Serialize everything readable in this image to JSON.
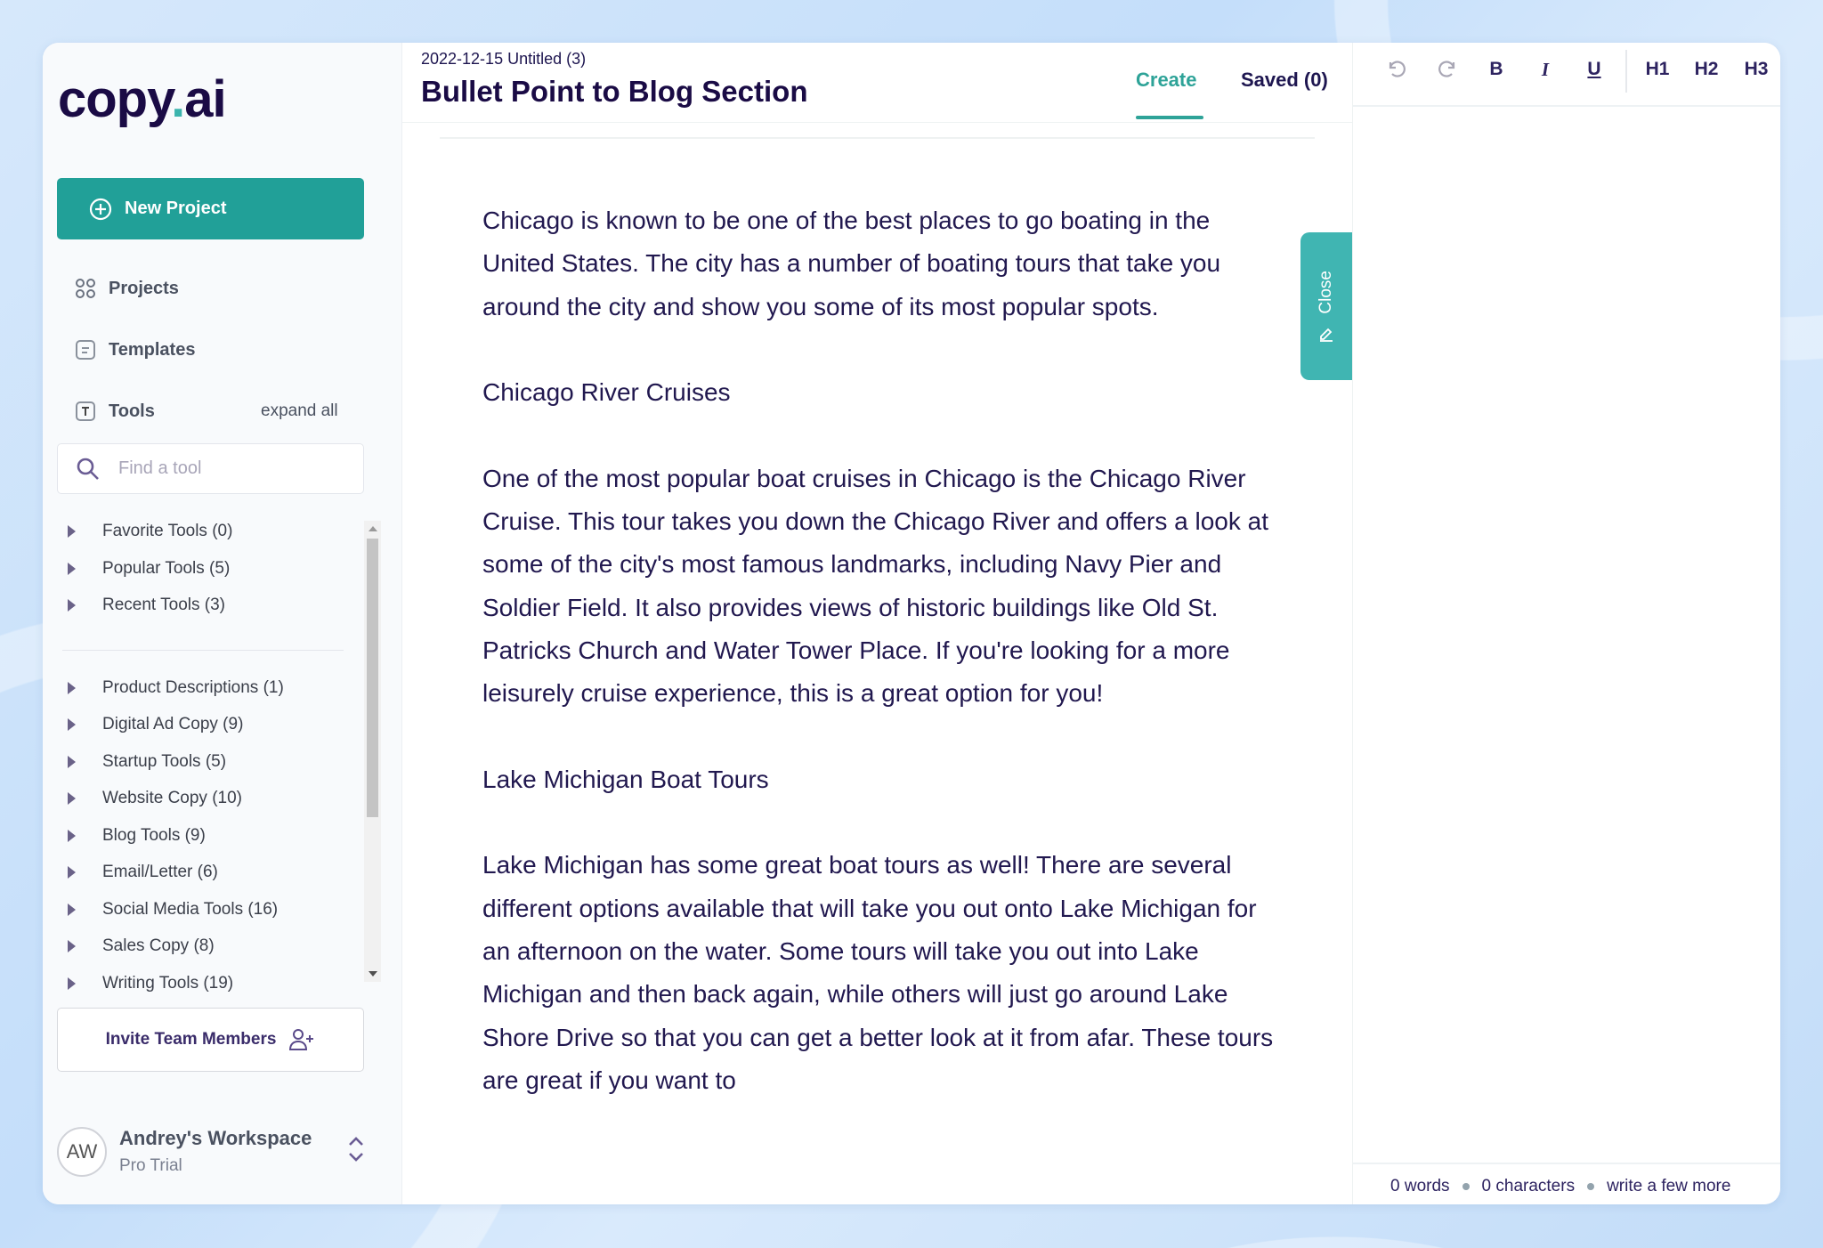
{
  "brand": {
    "logo_text_a": "copy",
    "logo_dot": ".",
    "logo_text_b": "ai",
    "accent": "#21a098"
  },
  "sidebar": {
    "new_project": "New Project",
    "nav": [
      {
        "label": "Projects",
        "icon": "grid-icon"
      },
      {
        "label": "Templates",
        "icon": "template-icon"
      },
      {
        "label": "Tools",
        "icon": "tools-icon"
      }
    ],
    "expand_all": "expand all",
    "search_placeholder": "Find a tool",
    "tool_groups_top": [
      "Favorite Tools (0)",
      "Popular Tools (5)",
      "Recent Tools (3)"
    ],
    "tool_groups": [
      "Product Descriptions (1)",
      "Digital Ad Copy (9)",
      "Startup Tools (5)",
      "Website Copy (10)",
      "Blog Tools (9)",
      "Email/Letter (6)",
      "Social Media Tools (16)",
      "Sales Copy (8)",
      "Writing Tools (19)"
    ],
    "invite": "Invite Team Members",
    "workspace": {
      "initials": "AW",
      "name": "Andrey's Workspace",
      "plan": "Pro Trial"
    }
  },
  "main": {
    "date": "2022-12-15 Untitled (3)",
    "title": "Bullet Point to Blog Section",
    "tabs": {
      "create": "Create",
      "saved": "Saved (0)"
    },
    "close": "Close",
    "content": [
      "Chicago is known to be one of the best places to go boating in the United States. The city has a number of boating tours that take you around the city and show you some of its most popular spots.",
      "Chicago River Cruises",
      "One of the most popular boat cruises in Chicago is the Chicago River Cruise. This tour takes you down the Chicago River and offers a look at some of the city's most famous landmarks, including Navy Pier and Soldier Field. It also provides views of historic buildings like Old St. Patricks Church and Water Tower Place. If you're looking for a more leisurely cruise experience, this is a great option for you!",
      "Lake Michigan Boat Tours",
      "Lake Michigan has some great boat tours as well! There are several different options available that will take you out onto Lake Michigan for an afternoon on the water. Some tours will take you out into Lake Michigan and then back again, while others will just go around Lake Shore Drive so that you can get a better look at it from afar. These tours are great if you want to"
    ]
  },
  "editor": {
    "toolbar": {
      "bold": "B",
      "italic": "I",
      "underline": "U",
      "h1": "H1",
      "h2": "H2",
      "h3": "H3"
    },
    "footer": {
      "words": "0 words",
      "characters": "0 characters",
      "hint": "write a few more"
    }
  }
}
